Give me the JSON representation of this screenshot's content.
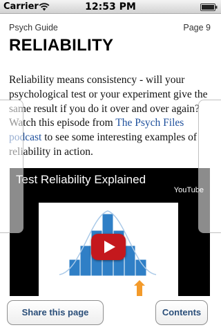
{
  "status_bar": {
    "carrier": "Carrier",
    "time": "12:53 PM"
  },
  "header": {
    "guide": "Psych Guide",
    "page": "Page 9"
  },
  "title": "RELIABILITY",
  "body": {
    "text_1": "Reliability means consistency - will your psychological test or your experiment give the same result if you do it over and over again? Watch this episode from ",
    "link": "The Psych Files podcast",
    "text_2": " to see some interesting examples of reliability in action."
  },
  "video": {
    "title": "Test Reliability Explained",
    "source": "YouTube"
  },
  "toolbar": {
    "share_label": "Share this page",
    "contents_label": "Contents"
  },
  "colors": {
    "link": "#1d4f9c",
    "button_text": "#2a4e79",
    "chart_blue": "#2f7fc6",
    "play_red": "#c4181d",
    "arrow_orange": "#f39a2a"
  },
  "icons": [
    "wifi-icon",
    "battery-icon",
    "play-icon",
    "up-arrow-icon"
  ]
}
